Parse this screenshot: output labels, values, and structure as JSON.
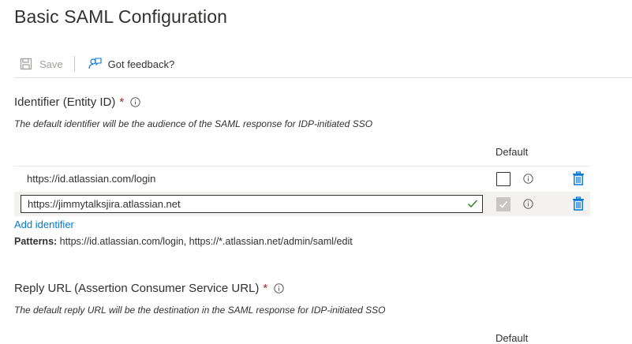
{
  "page": {
    "title": "Basic SAML Configuration"
  },
  "toolbar": {
    "save_label": "Save",
    "feedback_label": "Got feedback?"
  },
  "identifier": {
    "title": "Identifier (Entity ID)",
    "required_marker": "*",
    "description": "The default identifier will be the audience of the SAML response for IDP-initiated SSO",
    "default_column": "Default",
    "rows": [
      {
        "value": "https://id.atlassian.com/login",
        "default": false,
        "editing": false
      },
      {
        "value": "https://jimmytalksjira.atlassian.net",
        "default": true,
        "editing": true
      }
    ],
    "add_link": "Add identifier",
    "patterns_label": "Patterns:",
    "patterns_value": "https://id.atlassian.com/login, https://*.atlassian.net/admin/saml/edit"
  },
  "reply_url": {
    "title": "Reply URL (Assertion Consumer Service URL)",
    "required_marker": "*",
    "description": "The default reply URL will be the destination in the SAML response for IDP-initiated SSO",
    "default_column": "Default"
  },
  "colors": {
    "accent": "#0078d4",
    "required": "#a4262c",
    "valid": "#107c10"
  }
}
